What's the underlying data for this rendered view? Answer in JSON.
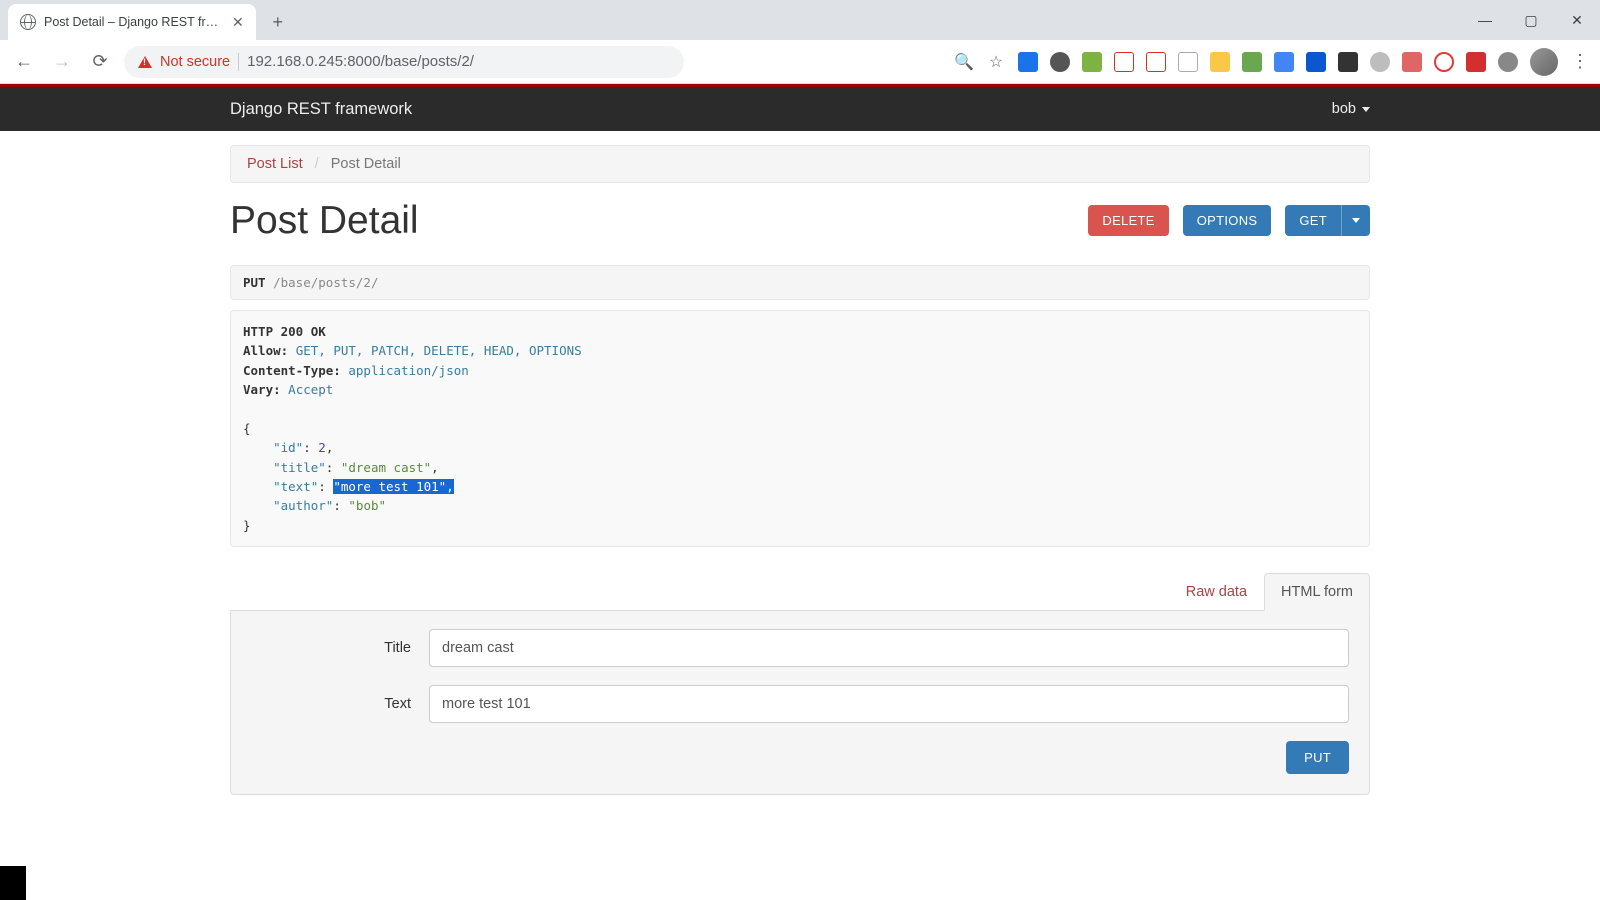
{
  "browser": {
    "tab_title": "Post Detail – Django REST framew",
    "url": "192.168.0.245:8000/base/posts/2/",
    "not_secure": "Not secure"
  },
  "navbar": {
    "brand": "Django REST framework",
    "user": "bob"
  },
  "breadcrumb": {
    "parent": "Post List",
    "sep": "/",
    "current": "Post Detail"
  },
  "page_title": "Post Detail",
  "buttons": {
    "delete": "DELETE",
    "options": "OPTIONS",
    "get": "GET",
    "put": "PUT"
  },
  "request": {
    "method": "PUT",
    "path": "/base/posts/2/"
  },
  "response": {
    "status_line": "HTTP 200 OK",
    "allow_label": "Allow:",
    "allow_value": "GET, PUT, PATCH, DELETE, HEAD, OPTIONS",
    "ctype_label": "Content-Type:",
    "ctype_value": "application/json",
    "vary_label": "Vary:",
    "vary_value": "Accept",
    "body": {
      "id_key": "\"id\"",
      "id_val": "2",
      "title_key": "\"title\"",
      "title_val": "\"dream cast\"",
      "text_key": "\"text\"",
      "text_val": "\"more test 101\"",
      "author_key": "\"author\"",
      "author_val": "\"bob\""
    }
  },
  "form_tabs": {
    "raw": "Raw data",
    "html": "HTML form"
  },
  "form": {
    "title_label": "Title",
    "title_value": "dream cast",
    "text_label": "Text",
    "text_value": "more test 101"
  }
}
